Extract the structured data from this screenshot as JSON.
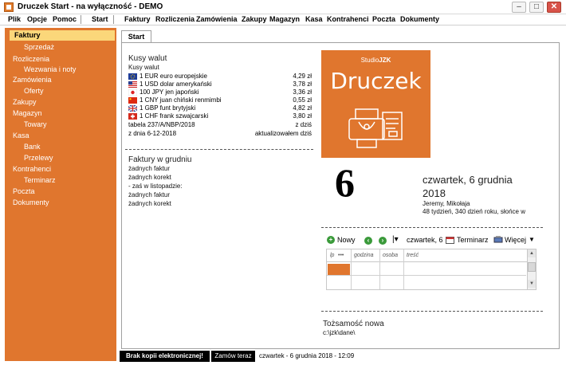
{
  "window": {
    "title": "Druczek Start - na wyłączność - DEMO"
  },
  "menu": {
    "items": [
      "Plik",
      "Opcje",
      "Pomoc",
      "Start",
      "Faktury",
      "Rozliczenia",
      "Zamówienia",
      "Zakupy",
      "Magazyn",
      "Kasa",
      "Kontrahenci",
      "Poczta",
      "Dokumenty"
    ]
  },
  "sidebar": {
    "items": [
      {
        "label": "Faktury"
      },
      {
        "label": "Sprzedaż"
      },
      {
        "label": "Rozliczenia"
      },
      {
        "label": "Wezwania i noty"
      },
      {
        "label": "Zamówienia"
      },
      {
        "label": "Oferty"
      },
      {
        "label": "Zakupy"
      },
      {
        "label": "Magazyn"
      },
      {
        "label": "Towary"
      },
      {
        "label": "Kasa"
      },
      {
        "label": "Bank"
      },
      {
        "label": "Przelewy"
      },
      {
        "label": "Kontrahenci"
      },
      {
        "label": "Terminarz"
      },
      {
        "label": "Poczta"
      },
      {
        "label": "Dokumenty"
      }
    ]
  },
  "tab": {
    "label": "Start"
  },
  "currencies": {
    "title": "Kusy walut",
    "subtitle": "Kusy walut",
    "rows": [
      {
        "name": "1 EUR euro europejskie",
        "value": "4,29 zł",
        "flag": "eu"
      },
      {
        "name": "1 USD dolar amerykański",
        "value": "3,78 zł",
        "flag": "us"
      },
      {
        "name": "100 JPY jen japoński",
        "value": "3,36 zł",
        "flag": "jp"
      },
      {
        "name": "1 CNY juan chiński renmimbi",
        "value": "0,55 zł",
        "flag": "cn"
      },
      {
        "name": "1 GBP funt brytyjski",
        "value": "4,82 zł",
        "flag": "gb"
      },
      {
        "name": "1 CHF frank szwajcarski",
        "value": "3,80 zł",
        "flag": "ch"
      }
    ],
    "table_left": "tabela 237/A/NBP/2018",
    "table_right": "z dziś",
    "date_left": "z dnia 6-12-2018",
    "date_right": "aktualizowałem dziś"
  },
  "invoices": {
    "title": "Faktury w grudniu",
    "lines": [
      "żadnych faktur",
      "żadnych korekt",
      "- zaś w listopadzie:",
      "żadnych faktur",
      "żadnych korekt"
    ]
  },
  "logo": {
    "small_prefix": "Studio",
    "small_brand": "JZK",
    "name": "Druczek"
  },
  "calendar": {
    "day": "6",
    "date_line1": "czwartek, 6 grudnia",
    "date_line2": "2018",
    "names": "Jeremy, Mikołaja",
    "info": "48 tydzień, 340 dzień roku, słońce w"
  },
  "toolbar": {
    "new_label": "Nowy",
    "current_date": "czwartek, 6",
    "scheduler_label": "Terminarz",
    "more_label": "Więcej"
  },
  "grid": {
    "headers": [
      "lp",
      "godzina",
      "osoba",
      "treść"
    ]
  },
  "identity": {
    "title": "Tożsamość nowa",
    "path": "c:\\jzk\\dane\\"
  },
  "status": {
    "warning": "Brak kopii elektronicznej!",
    "order": "Zamów teraz",
    "datetime": "czwartek - 6 grudnia 2018 - 12:09"
  },
  "colors": {
    "accent": "#e0762e",
    "active": "#fbd77a"
  }
}
